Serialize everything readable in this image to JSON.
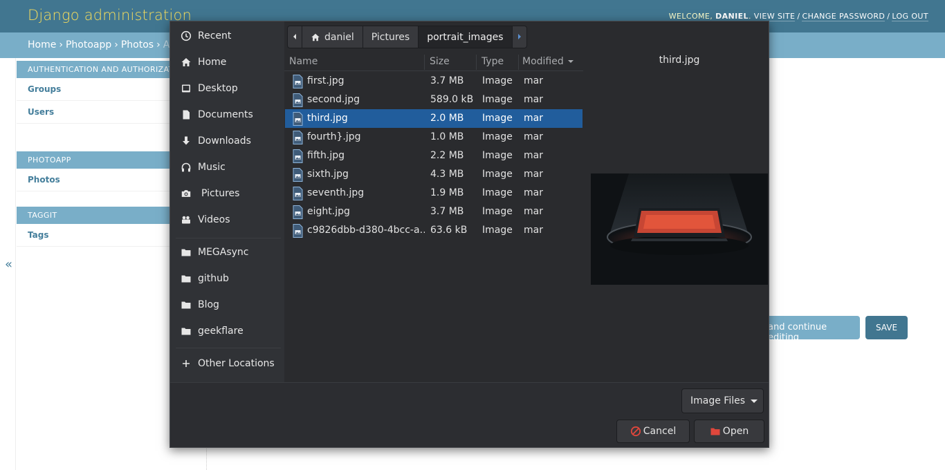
{
  "admin": {
    "brand": "Django administration",
    "welcome": "WELCOME,",
    "username": "DANIEL",
    "view_site": "VIEW SITE",
    "change_password": "CHANGE PASSWORD",
    "log_out": "LOG OUT",
    "breadcrumbs": {
      "home": "Home",
      "app": "Photoapp",
      "model": "Photos",
      "current": "Add p"
    },
    "sidebar": {
      "auth_title": "AUTHENTICATION AND AUTHORIZATION",
      "groups": "Groups",
      "users": "Users",
      "photoapp_title": "PHOTOAPP",
      "photos": "Photos",
      "taggit_title": "TAGGIT",
      "tags": "Tags"
    },
    "collapse": "«",
    "save_continue": "and continue editing",
    "save": "SAVE"
  },
  "chooser": {
    "places": [
      {
        "label": "Recent",
        "icon": "clock-icon"
      },
      {
        "label": "Home",
        "icon": "home-icon"
      },
      {
        "label": "Desktop",
        "icon": "desktop-icon"
      },
      {
        "label": "Documents",
        "icon": "document-icon"
      },
      {
        "label": "Downloads",
        "icon": "download-icon"
      },
      {
        "label": "Music",
        "icon": "headphones-icon"
      },
      {
        "label": "Pictures",
        "icon": "camera-icon"
      },
      {
        "label": "Videos",
        "icon": "video-icon"
      },
      {
        "label": "MEGAsync",
        "icon": "folder-icon"
      },
      {
        "label": "github",
        "icon": "folder-icon"
      },
      {
        "label": "Blog",
        "icon": "folder-icon"
      },
      {
        "label": "geekflare",
        "icon": "folder-icon"
      },
      {
        "label": "Other Locations",
        "icon": "plus-icon"
      }
    ],
    "path": [
      "daniel",
      "Pictures",
      "portrait_images"
    ],
    "columns": {
      "name": "Name",
      "size": "Size",
      "type": "Type",
      "modified": "Modified"
    },
    "files": [
      {
        "name": "first.jpg",
        "size": "3.7 MB",
        "type": "Image",
        "modified": "mar"
      },
      {
        "name": "second.jpg",
        "size": "589.0 kB",
        "type": "Image",
        "modified": "mar"
      },
      {
        "name": "third.jpg",
        "size": "2.0 MB",
        "type": "Image",
        "modified": "mar"
      },
      {
        "name": "fourth}.jpg",
        "size": "1.0 MB",
        "type": "Image",
        "modified": "mar"
      },
      {
        "name": "fifth.jpg",
        "size": "2.2 MB",
        "type": "Image",
        "modified": "mar"
      },
      {
        "name": "sixth.jpg",
        "size": "4.3 MB",
        "type": "Image",
        "modified": "mar"
      },
      {
        "name": "seventh.jpg",
        "size": "1.9 MB",
        "type": "Image",
        "modified": "mar"
      },
      {
        "name": "eight.jpg",
        "size": "3.7 MB",
        "type": "Image",
        "modified": "mar"
      },
      {
        "name": "c9826dbb-d380-4bcc-a…",
        "size": "63.6 kB",
        "type": "Image",
        "modified": "mar"
      }
    ],
    "selected_index": 2,
    "preview_name": "third.jpg",
    "filter": "Image Files",
    "cancel": "Cancel",
    "open": "Open",
    "colors": {
      "selection": "#215d9c",
      "django_header": "#417690",
      "django_accent": "#79aec8",
      "brand": "#f5dd5d"
    }
  }
}
